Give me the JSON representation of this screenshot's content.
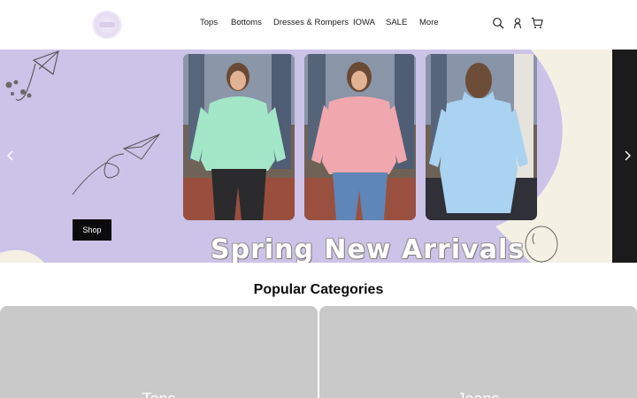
{
  "header": {
    "logo_icon": "boutique-logo",
    "nav": [
      {
        "label": "Tops"
      },
      {
        "label": "Bottoms"
      },
      {
        "label": "Dresses & Rompers"
      },
      {
        "label": "IOWA"
      },
      {
        "label": "SALE"
      },
      {
        "label": "More"
      }
    ],
    "icons": [
      "search-icon",
      "account-icon",
      "cart-icon"
    ]
  },
  "hero": {
    "background_color": "#ccc3e8",
    "shop_label": "Shop",
    "banner_text": "Spring New Arrivals",
    "prev_icon": "chevron-left-icon",
    "next_icon": "chevron-right-icon",
    "photos": [
      {
        "name": "model-mint-hoodie",
        "top_color": "#9fe0c3"
      },
      {
        "name": "model-pink-sweater",
        "top_color": "#eea3ab"
      },
      {
        "name": "model-blue-hoodie-back",
        "top_color": "#a9d2f0"
      }
    ]
  },
  "categories": {
    "title": "Popular Categories",
    "items": [
      {
        "label": "Tops"
      },
      {
        "label": "Jeans"
      }
    ]
  }
}
